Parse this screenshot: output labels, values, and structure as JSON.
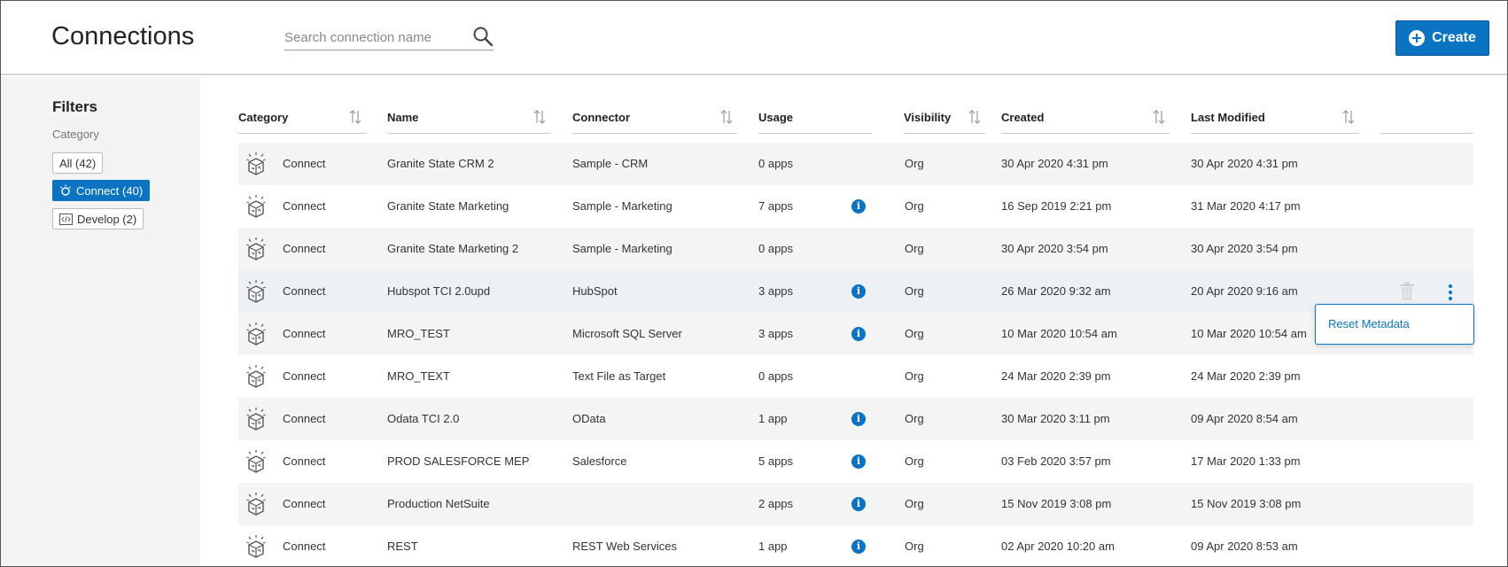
{
  "header": {
    "title": "Connections",
    "search_placeholder": "Search connection name",
    "create_label": "Create"
  },
  "sidebar": {
    "title": "Filters",
    "category_label": "Category",
    "chips": [
      {
        "label": "All (42)",
        "active": false
      },
      {
        "label": "Connect (40)",
        "active": true
      },
      {
        "label": "Develop (2)",
        "active": false
      }
    ]
  },
  "table": {
    "columns": [
      "Category",
      "Name",
      "Connector",
      "Usage",
      "Visibility",
      "Created",
      "Last Modified"
    ],
    "rows": [
      {
        "category": "Connect",
        "name": "Granite State CRM 2",
        "connector": "Sample - CRM",
        "usage": "0 apps",
        "info": false,
        "visibility": "Org",
        "created": "30 Apr 2020 4:31 pm",
        "modified": "30 Apr 2020 4:31 pm"
      },
      {
        "category": "Connect",
        "name": "Granite State Marketing",
        "connector": "Sample - Marketing",
        "usage": "7 apps",
        "info": true,
        "visibility": "Org",
        "created": "16 Sep 2019 2:21 pm",
        "modified": "31 Mar 2020 4:17 pm"
      },
      {
        "category": "Connect",
        "name": "Granite State Marketing 2",
        "connector": "Sample - Marketing",
        "usage": "0 apps",
        "info": false,
        "visibility": "Org",
        "created": "30 Apr 2020 3:54 pm",
        "modified": "30 Apr 2020 3:54 pm"
      },
      {
        "category": "Connect",
        "name": "Hubspot TCI 2.0upd",
        "connector": "HubSpot",
        "usage": "3 apps",
        "info": true,
        "visibility": "Org",
        "created": "26 Mar 2020 9:32 am",
        "modified": "20 Apr 2020 9:16 am"
      },
      {
        "category": "Connect",
        "name": "MRO_TEST",
        "connector": "Microsoft SQL Server",
        "usage": "3 apps",
        "info": true,
        "visibility": "Org",
        "created": "10 Mar 2020 10:54 am",
        "modified": "10 Mar 2020 10:54 am"
      },
      {
        "category": "Connect",
        "name": "MRO_TEXT",
        "connector": "Text File as Target",
        "usage": "0 apps",
        "info": false,
        "visibility": "Org",
        "created": "24 Mar 2020 2:39 pm",
        "modified": "24 Mar 2020 2:39 pm"
      },
      {
        "category": "Connect",
        "name": "Odata TCI 2.0",
        "connector": "OData",
        "usage": "1 app",
        "info": true,
        "visibility": "Org",
        "created": "30 Mar 2020 3:11 pm",
        "modified": "09 Apr 2020 8:54 am"
      },
      {
        "category": "Connect",
        "name": "PROD SALESFORCE MEP",
        "connector": "Salesforce",
        "usage": "5 apps",
        "info": true,
        "visibility": "Org",
        "created": "03 Feb 2020 3:57 pm",
        "modified": "17 Mar 2020 1:33 pm"
      },
      {
        "category": "Connect",
        "name": "Production NetSuite",
        "connector": "",
        "usage": "2 apps",
        "info": true,
        "visibility": "Org",
        "created": "15 Nov 2019 3:08 pm",
        "modified": "15 Nov 2019 3:08 pm"
      },
      {
        "category": "Connect",
        "name": "REST",
        "connector": "REST Web Services",
        "usage": "1 app",
        "info": true,
        "visibility": "Org",
        "created": "02 Apr 2020 10:20 am",
        "modified": "09 Apr 2020 8:53 am"
      }
    ]
  },
  "row_menu": {
    "item": "Reset Metadata"
  },
  "colors": {
    "accent": "#0a74c2",
    "sidebar_bg": "#f3f3f3",
    "row_alt_bg": "#f4f4f4"
  },
  "icons": {
    "search": "search-icon",
    "create": "plus-circle-icon",
    "category": "connect-cube-icon",
    "sort": "sort-arrows-icon",
    "info": "info-icon",
    "delete": "trash-icon",
    "more": "kebab-menu-icon"
  }
}
